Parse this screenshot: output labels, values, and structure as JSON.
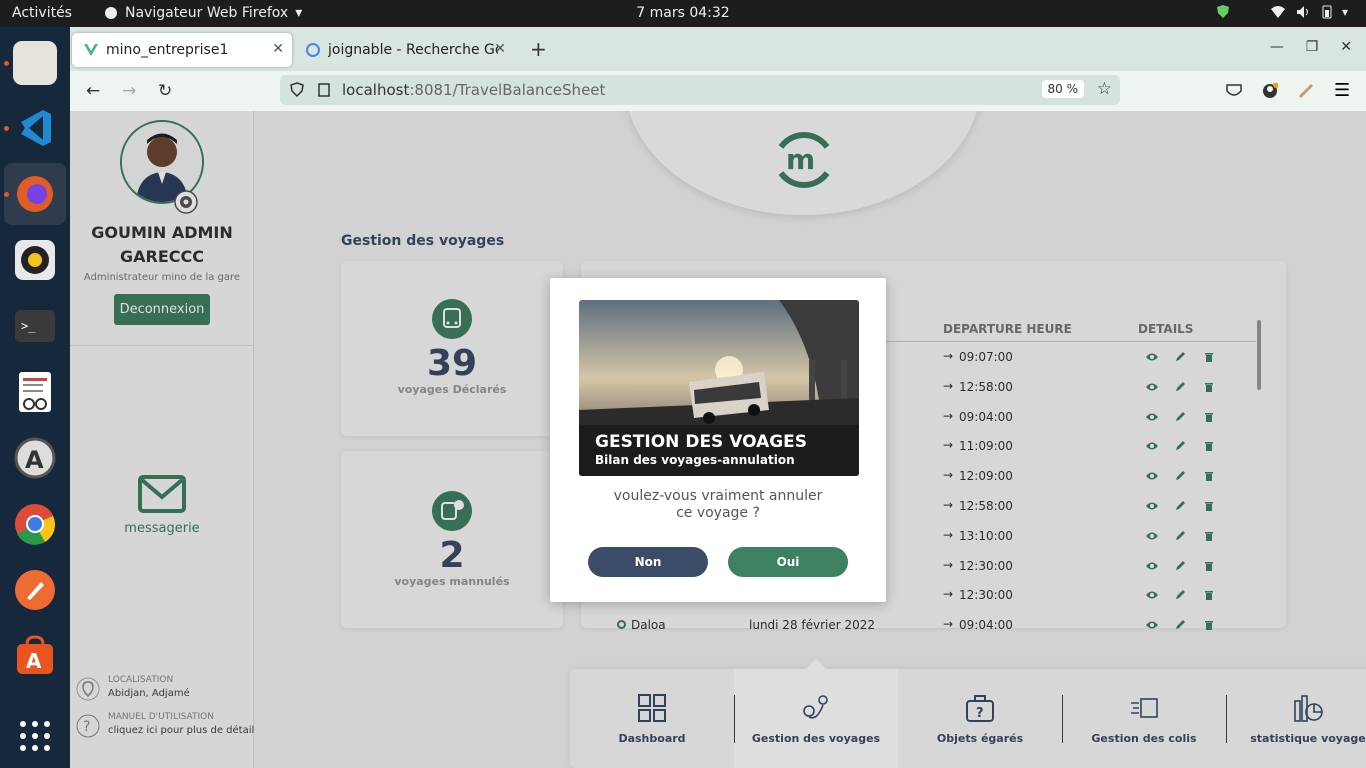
{
  "system_bar": {
    "activities": "Activités",
    "app_name": "Navigateur Web Firefox",
    "clock": "7 mars  04:32"
  },
  "browser": {
    "tabs": [
      {
        "label": "mino_entreprise1",
        "active": true
      },
      {
        "label": "joignable - Recherche Go",
        "active": false
      }
    ],
    "new_tab": "+",
    "url_host": "localhost",
    "url_path": ":8081/TravelBalanceSheet",
    "zoom": "80 %"
  },
  "sidebar": {
    "user_name_line1": "GOUMIN ADMIN",
    "user_name_line2": "GARECCC",
    "role": "Administrateur mino de la gare",
    "logout_label": "Deconnexion",
    "messaging_label": "messagerie",
    "location_title": "LOCALISATION",
    "location_value": "Abidjan, Adjamé",
    "manual_title": "MANUEL D'UTILISATION",
    "manual_value": "cliquez ici pour plus de détails"
  },
  "main": {
    "section_title": "Gestion des voyages",
    "stats": [
      {
        "value": "39",
        "label": "voyages Déclarés"
      },
      {
        "value": "2",
        "label": "voyages mannulés"
      }
    ],
    "table": {
      "col_departure": "DEPARTURE HEURE",
      "col_details": "DETAILS",
      "times": [
        "09:07:00",
        "12:58:00",
        "09:04:00",
        "11:09:00",
        "12:09:00",
        "12:58:00",
        "13:10:00",
        "12:30:00",
        "12:30:00",
        "09:04:00"
      ],
      "last_row_city": "Daloa",
      "last_row_date": "lundi 28 février 2022"
    }
  },
  "bottom_nav": [
    {
      "label": "Dashboard"
    },
    {
      "label": "Gestion des voyages"
    },
    {
      "label": "Objets égarés"
    },
    {
      "label": "Gestion des colis"
    },
    {
      "label": "statistique voyage"
    }
  ],
  "modal": {
    "banner_title": "GESTION DES VOAGES",
    "banner_subtitle": "Bilan des voyages-annulation",
    "question_line1": "voulez-vous vraiment annuler",
    "question_line2": "ce voyage ?",
    "no_label": "Non",
    "yes_label": "Oui"
  },
  "colors": {
    "brand_green": "#3e8062",
    "navy": "#3b4c68",
    "dock": "#16283c"
  }
}
